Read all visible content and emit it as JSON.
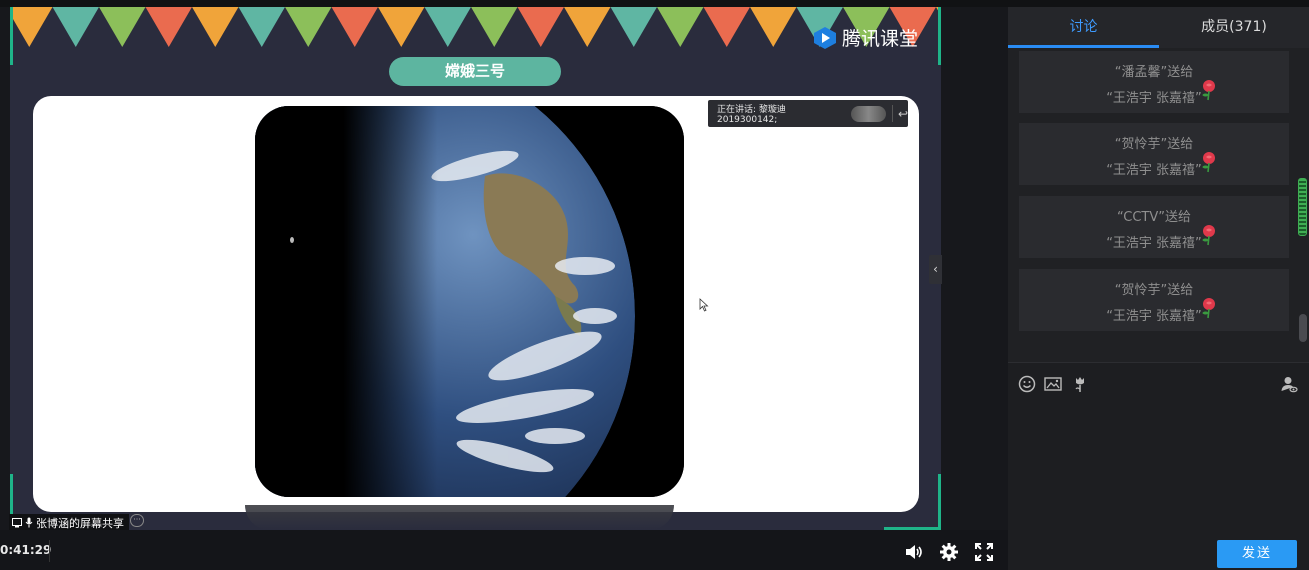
{
  "slide": {
    "brand_name": "腾讯课堂",
    "title": "嫦娥三号"
  },
  "speaking": {
    "text": "正在讲话: 黎璇迪2019300142;"
  },
  "share": {
    "label": "张博涵的屏幕共享"
  },
  "controls": {
    "timer": "0:41:29"
  },
  "side": {
    "tabs": [
      {
        "label": "讨论"
      },
      {
        "label": "成员(371)"
      }
    ],
    "messages": [
      {
        "line1": "“潘孟馨”送给",
        "line2": "“王浩宇 张嘉禧”"
      },
      {
        "line1": "“贺怜芋”送给",
        "line2": "“王浩宇 张嘉禧”"
      },
      {
        "line1": "“CCTV”送给",
        "line2": "“王浩宇 张嘉禧”"
      },
      {
        "line1": "“贺怜芋”送给",
        "line2": "“王浩宇 张嘉禧”"
      }
    ],
    "send_label": "发送"
  },
  "colors": {
    "accent": "#2a9af4",
    "slide_bg": "#2a2c3d",
    "pill": "#5db5a0",
    "corner": "#1fb489"
  }
}
